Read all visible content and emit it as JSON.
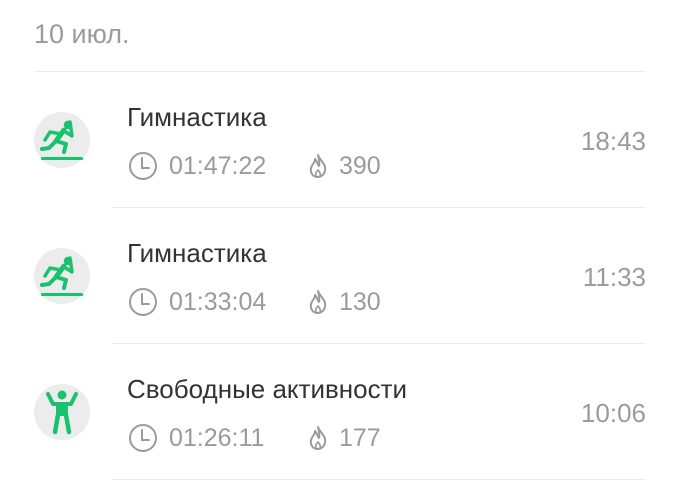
{
  "date_header": "10 июл.",
  "accent_color": "#1bc26e",
  "workouts": [
    {
      "title": "Гимнастика",
      "duration": "01:47:22",
      "calories": "390",
      "time": "18:43",
      "icon": "gymnastics-icon"
    },
    {
      "title": "Гимнастика",
      "duration": "01:33:04",
      "calories": "130",
      "time": "11:33",
      "icon": "gymnastics-icon"
    },
    {
      "title": "Свободные активности",
      "duration": "01:26:11",
      "calories": "177",
      "time": "10:06",
      "icon": "free-activity-icon"
    }
  ]
}
